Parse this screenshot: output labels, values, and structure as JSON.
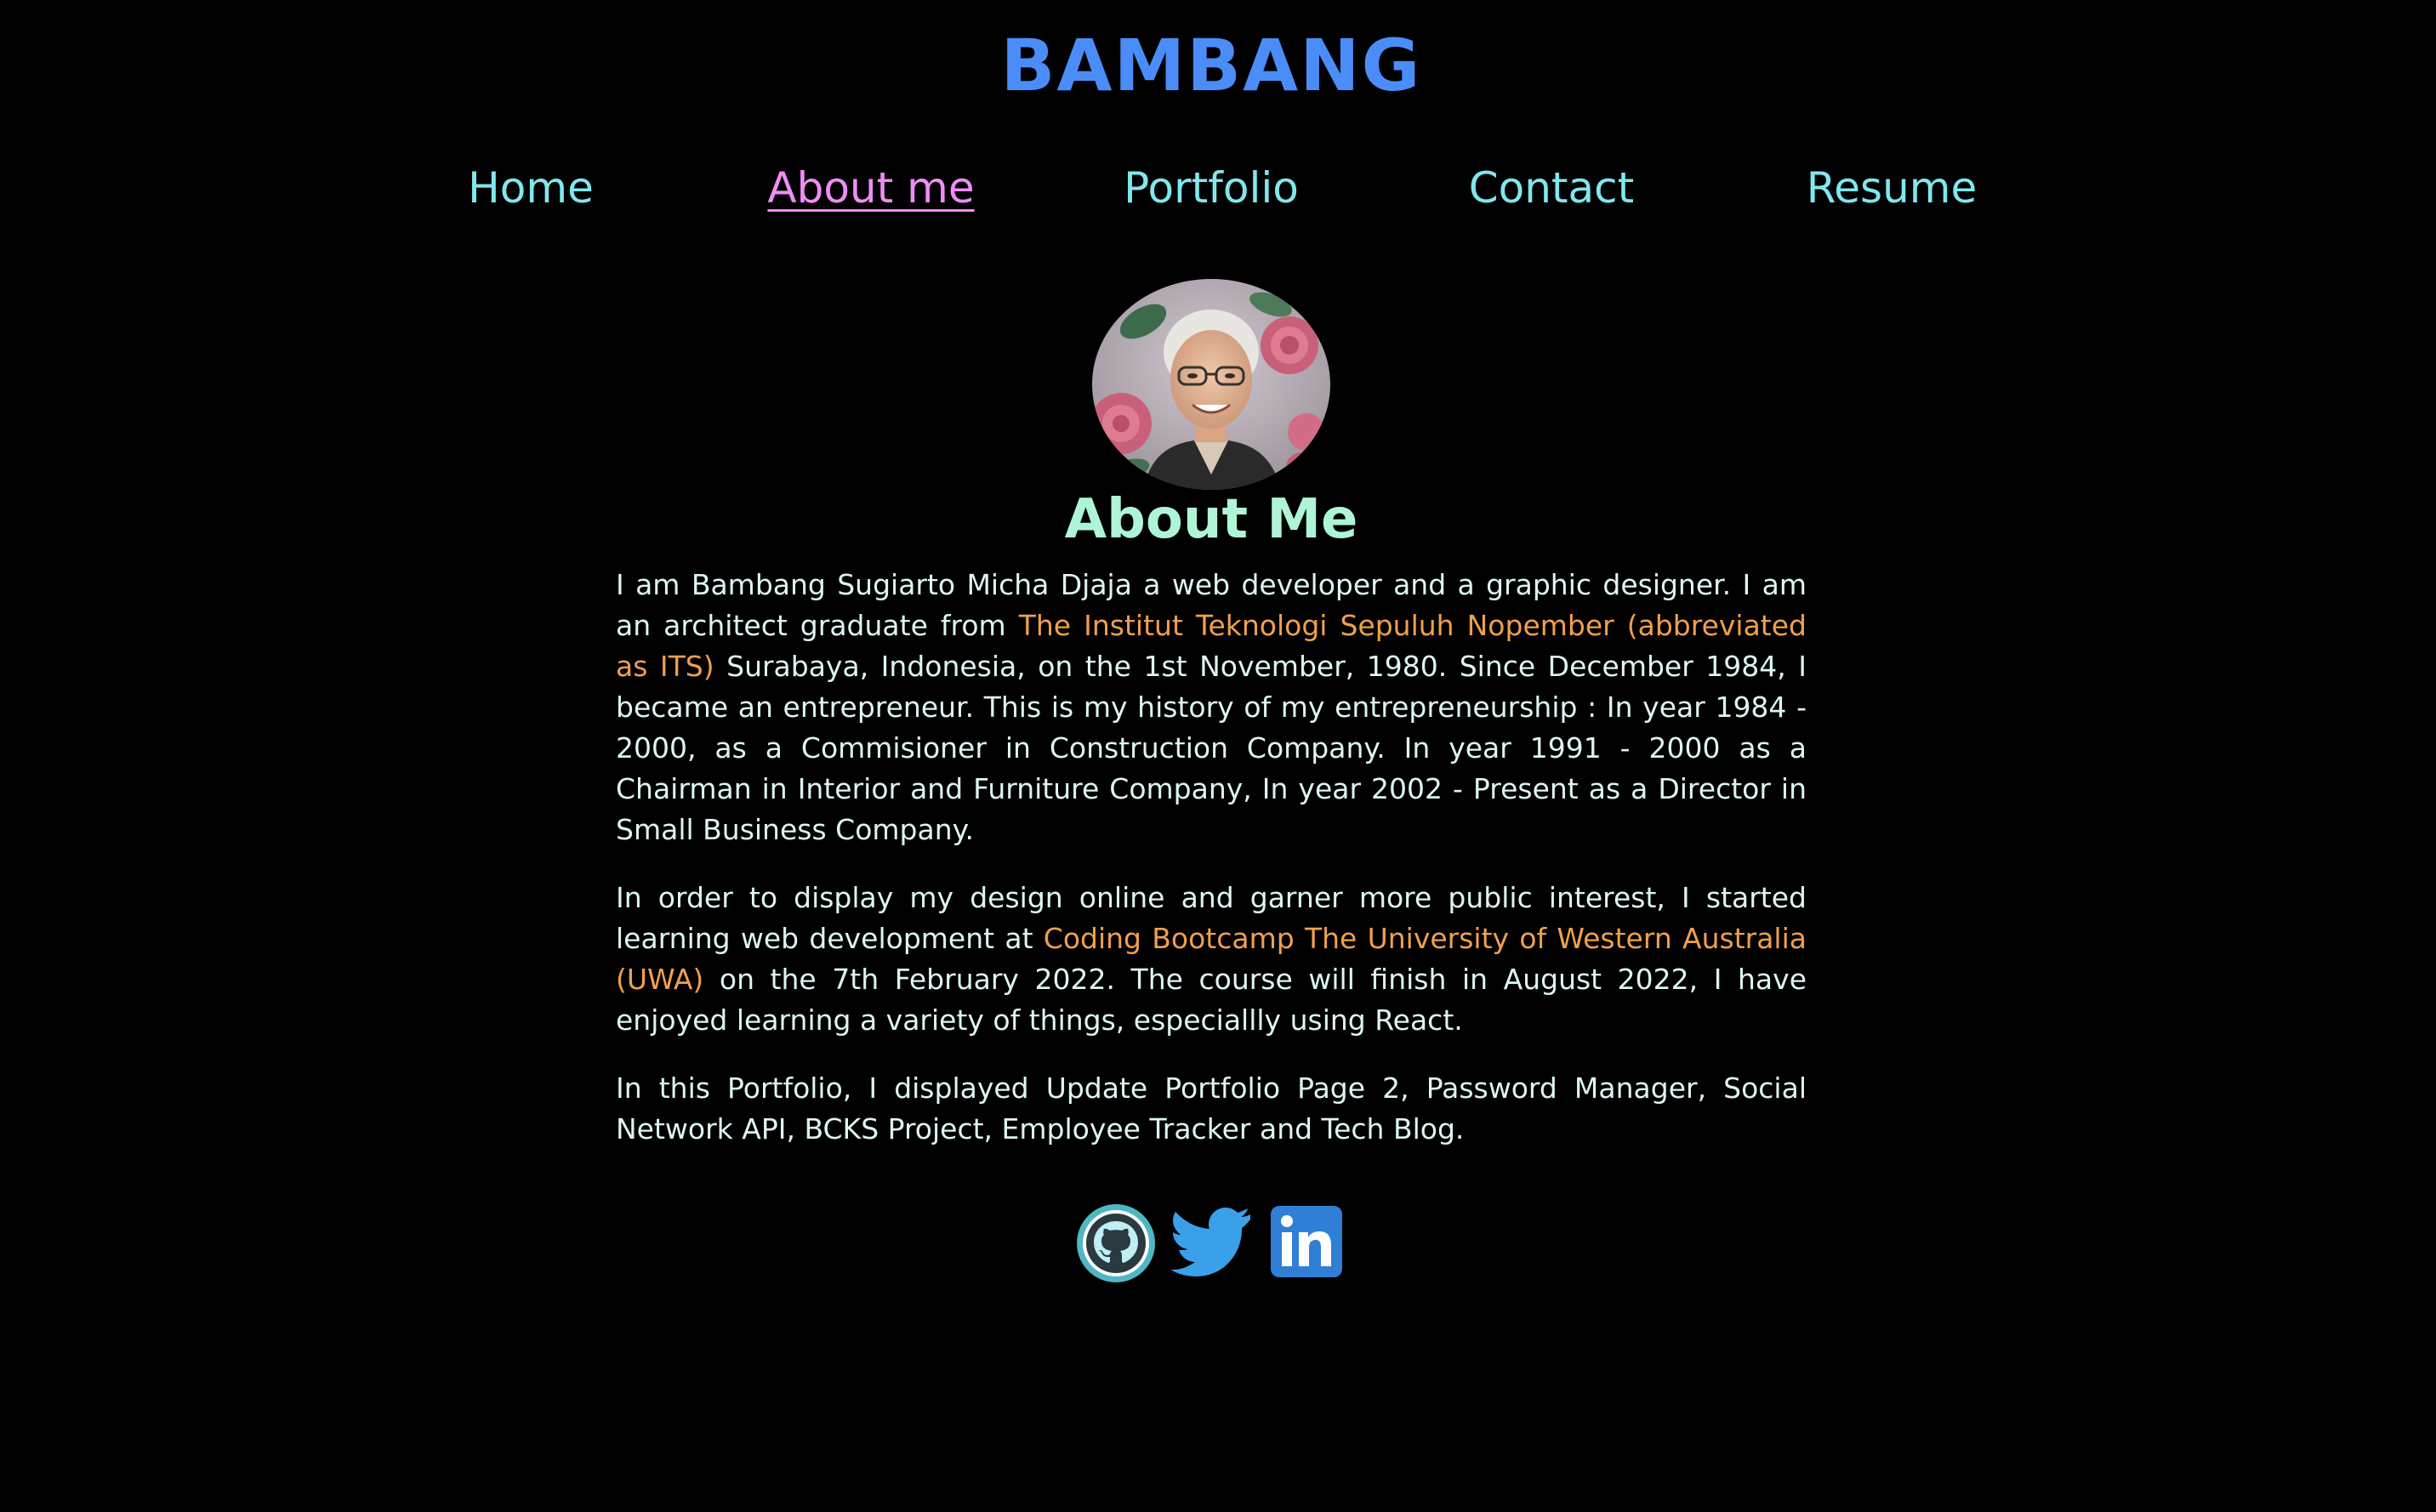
{
  "site": {
    "title": "BAMBANG",
    "title_color": "#4b8df8"
  },
  "nav": {
    "items": [
      {
        "label": "Home",
        "active": false
      },
      {
        "label": "About me",
        "active": true
      },
      {
        "label": "Portfolio",
        "active": false
      },
      {
        "label": "Contact",
        "active": false
      },
      {
        "label": "Resume",
        "active": false
      }
    ],
    "color": "#7fe8ee",
    "active_color": "#f08df5"
  },
  "about": {
    "heading": "About Me",
    "heading_color": "#aef5d6",
    "paragraph1": {
      "before": "I am Bambang Sugiarto Micha Djaja a web developer and a graphic designer. I am an architect graduate from ",
      "link": "The Institut Teknologi Sepuluh Nopember (abbreviated as ITS)",
      "after": " Surabaya, Indonesia, on the 1st November, 1980. Since December 1984, I became an entrepreneur. This is my history of my entrepreneurship : In year 1984 - 2000, as a Commisioner in Construction Company. In year 1991 - 2000 as a Chairman in Interior and Furniture Company, In year 2002 - Present as a Director in Small Business Company."
    },
    "paragraph2": {
      "before": "In order to display my design online and garner more public interest, I started learning web development at ",
      "link": "Coding Bootcamp The University of Western Australia (UWA)",
      "after": " on the 7th February 2022. The course will finish in August 2022, I have enjoyed learning a variety of things, especiallly using React."
    },
    "paragraph3": "In this Portfolio, I displayed Update Portfolio Page 2, Password Manager, Social Network API, BCKS Project, Employee Tracker and Tech Blog.",
    "text_color": "#dcf5f3",
    "link_color": "#f0a04b"
  },
  "socials": [
    {
      "icon": "github-icon"
    },
    {
      "icon": "twitter-icon"
    },
    {
      "icon": "linkedin-icon"
    }
  ]
}
